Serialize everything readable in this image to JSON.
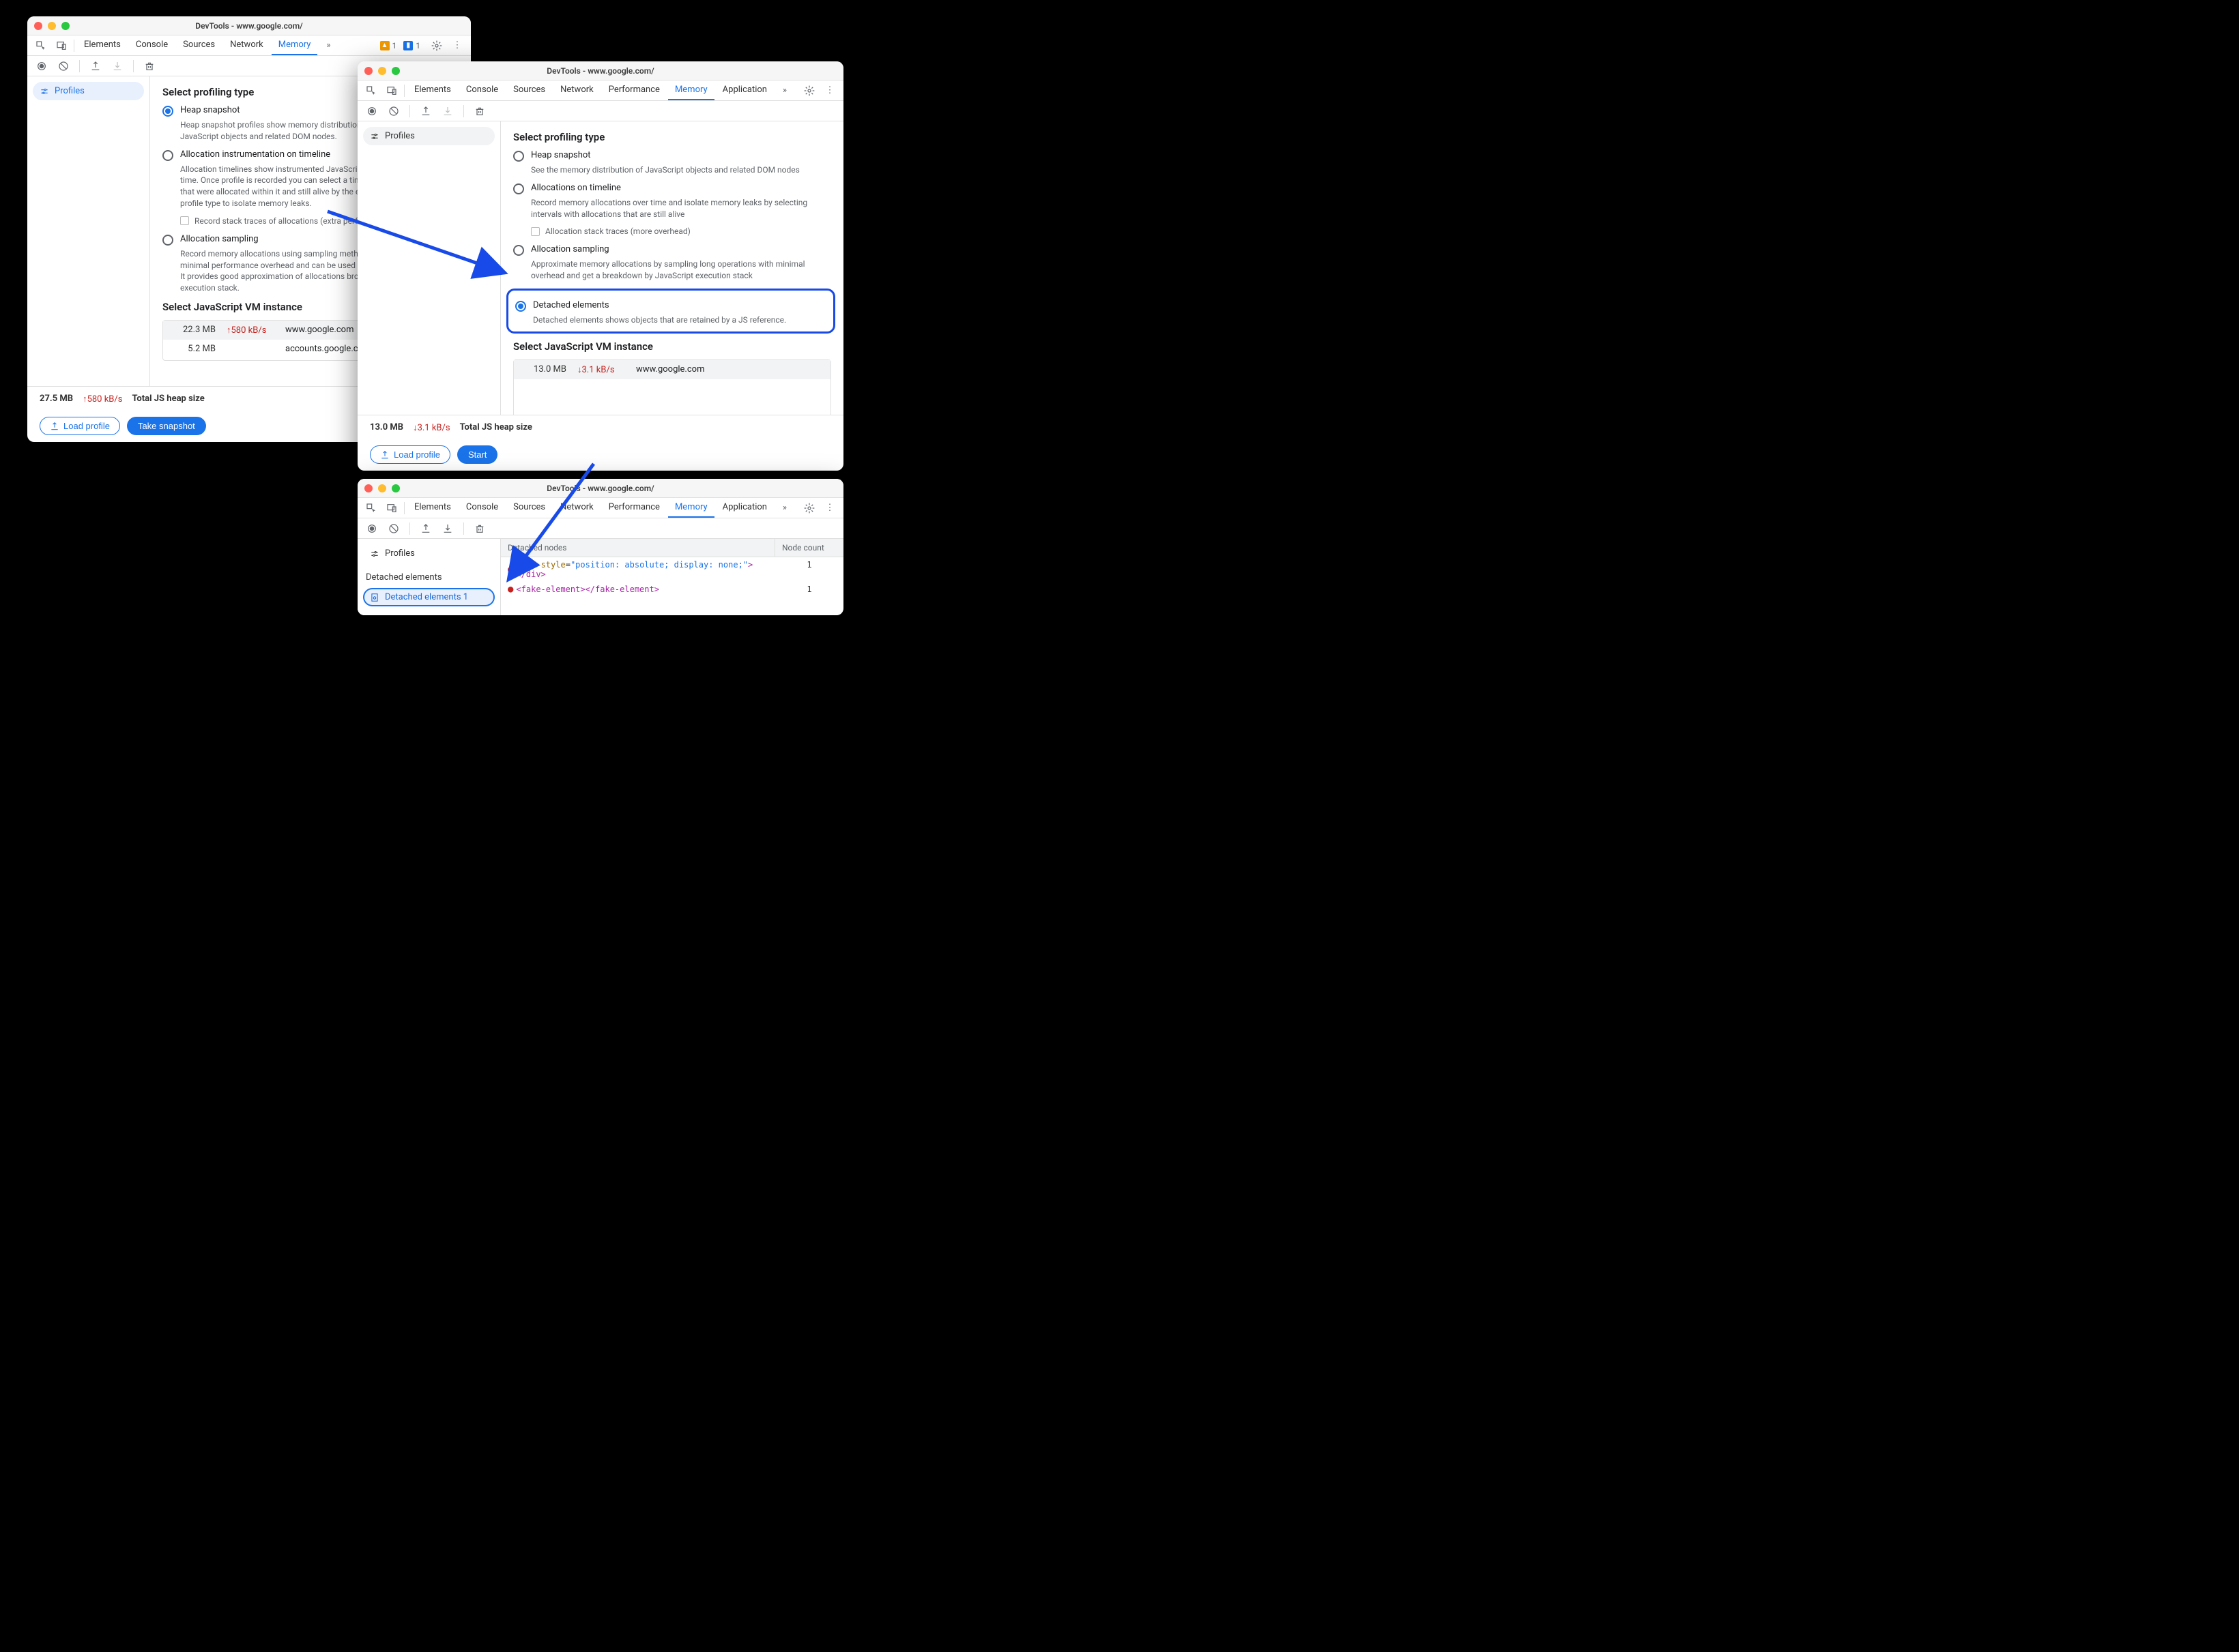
{
  "w1": {
    "title": "DevTools - www.google.com/",
    "tabs": [
      "Elements",
      "Console",
      "Sources",
      "Network",
      "Memory"
    ],
    "active_tab": "Memory",
    "warn_count": "1",
    "info_count": "1",
    "sidebar": {
      "profiles": "Profiles"
    },
    "section_title": "Select profiling type",
    "opts": [
      {
        "label": "Heap snapshot",
        "desc": "Heap snapshot profiles show memory distribution among your page's JavaScript objects and related DOM nodes."
      },
      {
        "label": "Allocation instrumentation on timeline",
        "desc": "Allocation timelines show instrumented JavaScript memory allocations over time. Once profile is recorded you can select a time interval to see objects that were allocated within it and still alive by the end of recording. Use this profile type to isolate memory leaks.",
        "sub": "Record stack traces of allocations (extra performance overhead)"
      },
      {
        "label": "Allocation sampling",
        "desc": "Record memory allocations using sampling method. This profile type has minimal performance overhead and can be used for long running operations. It provides good approximation of allocations broken down by JavaScript execution stack."
      }
    ],
    "vm_title": "Select JavaScript VM instance",
    "vm_rows": [
      {
        "size": "22.3 MB",
        "rate": "↑580 kB/s",
        "url": "www.google.com"
      },
      {
        "size": "5.2 MB",
        "rate": "",
        "url": "accounts.google.com: Root"
      }
    ],
    "total_size": "27.5 MB",
    "total_rate": "↑580 kB/s",
    "total_label": "Total JS heap size",
    "btn_load": "Load profile",
    "btn_action": "Take snapshot"
  },
  "w2": {
    "title": "DevTools - www.google.com/",
    "tabs": [
      "Elements",
      "Console",
      "Sources",
      "Network",
      "Performance",
      "Memory",
      "Application"
    ],
    "active_tab": "Memory",
    "sidebar": {
      "profiles": "Profiles"
    },
    "section_title": "Select profiling type",
    "opts": [
      {
        "label": "Heap snapshot",
        "desc": "See the memory distribution of JavaScript objects and related DOM nodes"
      },
      {
        "label": "Allocations on timeline",
        "desc": "Record memory allocations over time and isolate memory leaks by selecting intervals with allocations that are still alive",
        "sub": "Allocation stack traces (more overhead)"
      },
      {
        "label": "Allocation sampling",
        "desc": "Approximate memory allocations by sampling long operations with minimal overhead and get a breakdown by JavaScript execution stack"
      },
      {
        "label": "Detached elements",
        "desc": "Detached elements shows objects that are retained by a JS reference."
      }
    ],
    "vm_title": "Select JavaScript VM instance",
    "vm_rows": [
      {
        "size": "13.0 MB",
        "rate": "↓3.1 kB/s",
        "url": "www.google.com"
      }
    ],
    "total_size": "13.0 MB",
    "total_rate": "↓3.1 kB/s",
    "total_label": "Total JS heap size",
    "btn_load": "Load profile",
    "btn_action": "Start"
  },
  "w3": {
    "title": "DevTools - www.google.com/",
    "tabs": [
      "Elements",
      "Console",
      "Sources",
      "Network",
      "Performance",
      "Memory",
      "Application"
    ],
    "active_tab": "Memory",
    "sidebar": {
      "profiles": "Profiles",
      "section": "Detached elements",
      "item": "Detached elements 1"
    },
    "columns": [
      "Detached nodes",
      "Node count"
    ],
    "rows": [
      {
        "html": "<div style=\"position: absolute; display: none;\"></div>",
        "count": "1"
      },
      {
        "html": "<fake-element></fake-element>",
        "count": "1"
      }
    ]
  }
}
